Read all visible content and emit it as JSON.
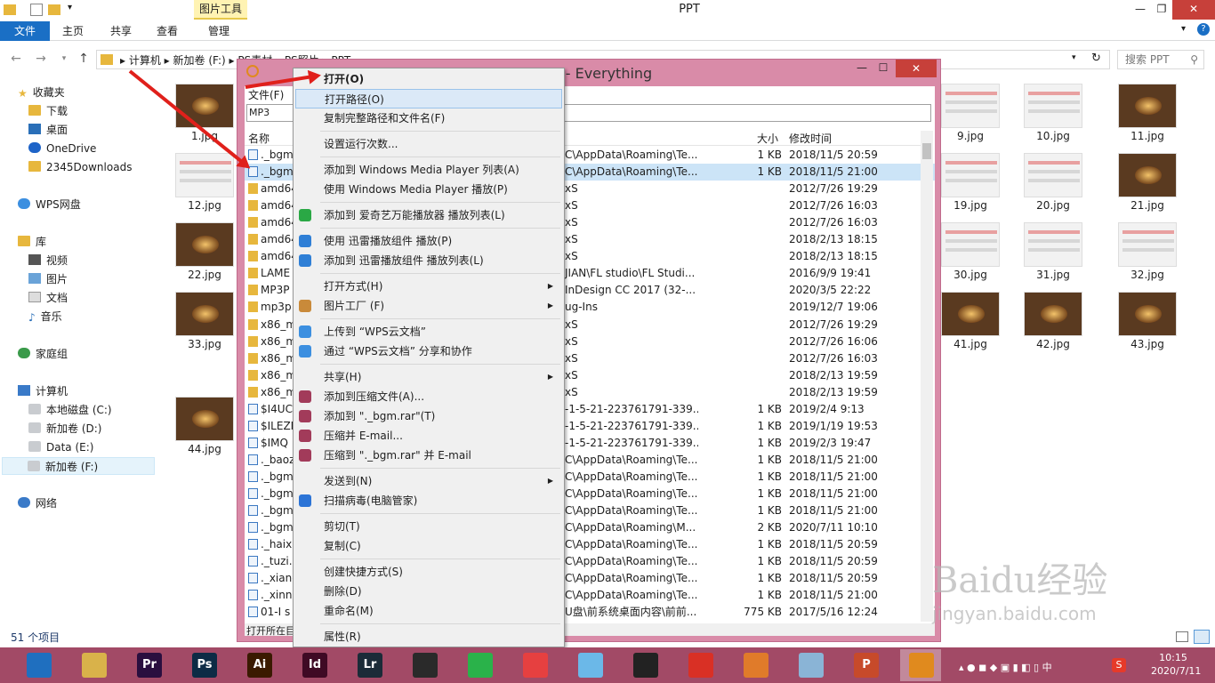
{
  "window": {
    "title": "PPT",
    "context_tab": "图片工具"
  },
  "ribbon": {
    "tabs": [
      "文件",
      "主页",
      "共享",
      "查看",
      "管理"
    ]
  },
  "address": {
    "crumbs": [
      "计算机",
      "新加卷 (F:)",
      "PS素材",
      "PS照片",
      "PPT"
    ],
    "search_placeholder": "搜索 PPT"
  },
  "nav": {
    "favorites": "收藏夹",
    "favorite_items": [
      "下载",
      "桌面",
      "OneDrive",
      "2345Downloads"
    ],
    "wps": "WPS网盘",
    "library": "库",
    "library_items": [
      "视频",
      "图片",
      "文档",
      "音乐"
    ],
    "homegroup": "家庭组",
    "computer": "计算机",
    "drives": [
      "本地磁盘 (C:)",
      "新加卷 (D:)",
      "Data (E:)",
      "新加卷 (F:)"
    ],
    "network": "网络"
  },
  "thumbs_left": [
    "1.jpg",
    "12.jpg",
    "22.jpg",
    "33.jpg",
    "44.jpg"
  ],
  "thumbs_right": [
    [
      "9.jpg",
      "10.jpg",
      "11.jpg"
    ],
    [
      "19.jpg",
      "20.jpg",
      "21.jpg"
    ],
    [
      "30.jpg",
      "31.jpg",
      "32.jpg"
    ],
    [
      "41.jpg",
      "42.jpg",
      "43.jpg"
    ]
  ],
  "status": "51 个项目",
  "everything": {
    "title": "MP3 - Everything",
    "menu_file": "文件(F)",
    "search_value": "MP3",
    "col_name": "名称",
    "col_size": "大小",
    "col_date": "修改时间",
    "statusbar": "打开所在目",
    "rows": [
      {
        "n": "._bgm",
        "p": "C\\AppData\\Roaming\\Te...",
        "s": "1 KB",
        "d": "2018/11/5 20:59",
        "t": "a"
      },
      {
        "n": "._bgm",
        "p": "C\\AppData\\Roaming\\Te...",
        "s": "1 KB",
        "d": "2018/11/5 21:00",
        "t": "a"
      },
      {
        "n": "amd64",
        "p": "xS",
        "s": "",
        "d": "2012/7/26 19:29",
        "t": "f"
      },
      {
        "n": "amd64",
        "p": "xS",
        "s": "",
        "d": "2012/7/26 16:03",
        "t": "f"
      },
      {
        "n": "amd64",
        "p": "xS",
        "s": "",
        "d": "2012/7/26 16:03",
        "t": "f"
      },
      {
        "n": "amd64",
        "p": "xS",
        "s": "",
        "d": "2018/2/13 18:15",
        "t": "f"
      },
      {
        "n": "amd64",
        "p": "xS",
        "s": "",
        "d": "2018/2/13 18:15",
        "t": "f"
      },
      {
        "n": "LAME",
        "p": "JIAN\\FL studio\\FL Studi...",
        "s": "",
        "d": "2016/9/9 19:41",
        "t": "f"
      },
      {
        "n": "MP3P",
        "p": "InDesign CC 2017 (32-...",
        "s": "",
        "d": "2020/3/5 22:22",
        "t": "f"
      },
      {
        "n": "mp3p",
        "p": "ug-Ins",
        "s": "",
        "d": "2019/12/7 19:06",
        "t": "f"
      },
      {
        "n": "x86_m",
        "p": "xS",
        "s": "",
        "d": "2012/7/26 19:29",
        "t": "f"
      },
      {
        "n": "x86_m",
        "p": "xS",
        "s": "",
        "d": "2012/7/26 16:06",
        "t": "f"
      },
      {
        "n": "x86_m",
        "p": "xS",
        "s": "",
        "d": "2012/7/26 16:03",
        "t": "f"
      },
      {
        "n": "x86_m",
        "p": "xS",
        "s": "",
        "d": "2018/2/13 19:59",
        "t": "f"
      },
      {
        "n": "x86_m",
        "p": "xS",
        "s": "",
        "d": "2018/2/13 19:59",
        "t": "f"
      },
      {
        "n": "$I4UC",
        "p": "-1-5-21-223761791-339...",
        "s": "1 KB",
        "d": "2019/2/4 9:13",
        "t": "a"
      },
      {
        "n": "$ILEZF",
        "p": "-1-5-21-223761791-339...",
        "s": "1 KB",
        "d": "2019/1/19 19:53",
        "t": "a"
      },
      {
        "n": "$IMQ",
        "p": "-1-5-21-223761791-339...",
        "s": "1 KB",
        "d": "2019/2/3 19:47",
        "t": "a"
      },
      {
        "n": "._baoz",
        "p": "C\\AppData\\Roaming\\Te...",
        "s": "1 KB",
        "d": "2018/11/5 21:00",
        "t": "a"
      },
      {
        "n": "._bgm",
        "p": "C\\AppData\\Roaming\\Te...",
        "s": "1 KB",
        "d": "2018/11/5 21:00",
        "t": "a"
      },
      {
        "n": "._bgm",
        "p": "C\\AppData\\Roaming\\Te...",
        "s": "1 KB",
        "d": "2018/11/5 21:00",
        "t": "a"
      },
      {
        "n": "._bgm",
        "p": "C\\AppData\\Roaming\\Te...",
        "s": "1 KB",
        "d": "2018/11/5 21:00",
        "t": "a"
      },
      {
        "n": "._bgm",
        "p": "C\\AppData\\Roaming\\M...",
        "s": "2 KB",
        "d": "2020/7/11 10:10",
        "t": "a"
      },
      {
        "n": "._haixi",
        "p": "C\\AppData\\Roaming\\Te...",
        "s": "1 KB",
        "d": "2018/11/5 20:59",
        "t": "a"
      },
      {
        "n": "._tuzi.r",
        "p": "C\\AppData\\Roaming\\Te...",
        "s": "1 KB",
        "d": "2018/11/5 20:59",
        "t": "a"
      },
      {
        "n": "._xiang",
        "p": "C\\AppData\\Roaming\\Te...",
        "s": "1 KB",
        "d": "2018/11/5 20:59",
        "t": "a"
      },
      {
        "n": "._xinni",
        "p": "C\\AppData\\Roaming\\Te...",
        "s": "1 KB",
        "d": "2018/11/5 21:00",
        "t": "a"
      },
      {
        "n": "01-I s",
        "p": "U盘\\前系统桌面内容\\前前...",
        "s": "775 KB",
        "d": "2017/5/16 12:24",
        "t": "a"
      }
    ]
  },
  "menu": {
    "items": [
      {
        "label": "打开(O)",
        "bold": true,
        "sub": false,
        "icon": ""
      },
      {
        "label": "打开路径(O)",
        "sub": false,
        "icon": "",
        "hl": true
      },
      {
        "label": "复制完整路径和文件名(F)",
        "sub": false,
        "icon": ""
      },
      {
        "sep": true
      },
      {
        "label": "设置运行次数...",
        "sub": false,
        "icon": ""
      },
      {
        "sep": true
      },
      {
        "label": "添加到 Windows Media Player 列表(A)",
        "sub": false,
        "icon": ""
      },
      {
        "label": "使用 Windows Media Player 播放(P)",
        "sub": false,
        "icon": ""
      },
      {
        "sep": true
      },
      {
        "label": "添加到 爱奇艺万能播放器 播放列表(L)",
        "sub": false,
        "icon": "#2aa845"
      },
      {
        "sep": true
      },
      {
        "label": "使用 迅雷播放组件 播放(P)",
        "sub": false,
        "icon": "#2f7fd6"
      },
      {
        "label": "添加到 迅雷播放组件 播放列表(L)",
        "sub": false,
        "icon": "#2f7fd6"
      },
      {
        "sep": true
      },
      {
        "label": "打开方式(H)",
        "sub": true,
        "icon": ""
      },
      {
        "label": "图片工厂 (F)",
        "sub": true,
        "icon": "#c98a3a"
      },
      {
        "sep": true
      },
      {
        "label": "上传到 “WPS云文档”",
        "sub": false,
        "icon": "#3c8fe0"
      },
      {
        "label": "通过 “WPS云文档” 分享和协作",
        "sub": false,
        "icon": "#3c8fe0"
      },
      {
        "sep": true
      },
      {
        "label": "共享(H)",
        "sub": true,
        "icon": ""
      },
      {
        "label": "添加到压缩文件(A)...",
        "sub": false,
        "icon": "#a23b5a"
      },
      {
        "label": "添加到 \"._bgm.rar\"(T)",
        "sub": false,
        "icon": "#a23b5a"
      },
      {
        "label": "压缩并 E-mail...",
        "sub": false,
        "icon": "#a23b5a"
      },
      {
        "label": "压缩到 \"._bgm.rar\" 并 E-mail",
        "sub": false,
        "icon": "#a23b5a"
      },
      {
        "sep": true
      },
      {
        "label": "发送到(N)",
        "sub": true,
        "icon": ""
      },
      {
        "label": "扫描病毒(电脑管家)",
        "sub": false,
        "icon": "#2c74d6"
      },
      {
        "sep": true
      },
      {
        "label": "剪切(T)",
        "sub": false,
        "icon": ""
      },
      {
        "label": "复制(C)",
        "sub": false,
        "icon": ""
      },
      {
        "sep": true
      },
      {
        "label": "创建快捷方式(S)",
        "sub": false,
        "icon": ""
      },
      {
        "label": "删除(D)",
        "sub": false,
        "icon": ""
      },
      {
        "label": "重命名(M)",
        "sub": false,
        "icon": ""
      },
      {
        "sep": true
      },
      {
        "label": "属性(R)",
        "sub": false,
        "icon": ""
      }
    ]
  },
  "taskbar": {
    "apps": [
      {
        "name": "browser-360",
        "label": "",
        "color": "#1f6fbf"
      },
      {
        "name": "file-explorer",
        "label": "",
        "color": "#d9b24a"
      },
      {
        "name": "premiere",
        "label": "Pr",
        "color": "#2a0f3f"
      },
      {
        "name": "photoshop",
        "label": "Ps",
        "color": "#0d2b45"
      },
      {
        "name": "illustrator",
        "label": "Ai",
        "color": "#3a1a00"
      },
      {
        "name": "indesign",
        "label": "Id",
        "color": "#3f0a24"
      },
      {
        "name": "lightroom",
        "label": "Lr",
        "color": "#1b2b38"
      },
      {
        "name": "video-editor",
        "label": "",
        "color": "#2a2a2a"
      },
      {
        "name": "iqiyi",
        "label": "",
        "color": "#2ab24a"
      },
      {
        "name": "app-red",
        "label": "",
        "color": "#e64040"
      },
      {
        "name": "bird-app",
        "label": "",
        "color": "#6bb8e8"
      },
      {
        "name": "qq",
        "label": "",
        "color": "#222"
      },
      {
        "name": "chrome",
        "label": "",
        "color": "#d93025"
      },
      {
        "name": "foxmail",
        "label": "",
        "color": "#e07b2a"
      },
      {
        "name": "notepad",
        "label": "",
        "color": "#8ab4d6"
      },
      {
        "name": "powerpoint",
        "label": "P",
        "color": "#c74a2a"
      },
      {
        "name": "everything",
        "label": "",
        "color": "#e08a1e"
      }
    ],
    "clock_time": "10:15",
    "clock_date": "2020/7/11",
    "ime": "中"
  },
  "watermark": "Baidu经验",
  "watermark_url": "jingyan.baidu.com"
}
